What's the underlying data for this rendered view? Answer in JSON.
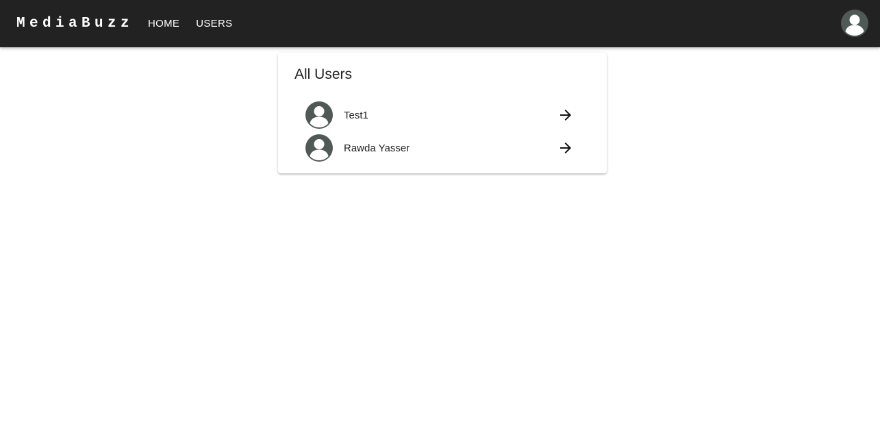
{
  "app": {
    "brand": "MediaBuzz"
  },
  "nav": {
    "items": [
      {
        "label": "HOME"
      },
      {
        "label": "USERS"
      }
    ]
  },
  "account": {
    "icon": "account-avatar-icon"
  },
  "users_card": {
    "title": "All Users",
    "users": [
      {
        "name": "Test1",
        "avatar_icon": "person-avatar-icon",
        "action_icon": "arrow-right-icon"
      },
      {
        "name": "Rawda Yasser",
        "avatar_icon": "person-avatar-icon",
        "action_icon": "arrow-right-icon"
      }
    ]
  },
  "colors": {
    "appbar": "#222222",
    "avatar_bg": "#4f5a56",
    "text": "#222222"
  }
}
